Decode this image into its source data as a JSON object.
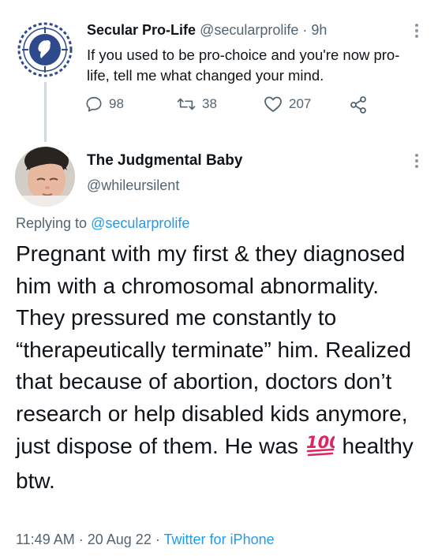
{
  "parent_tweet": {
    "name": "Secular Pro-Life",
    "handle": "@secularprolife",
    "separator": "·",
    "time": "9h",
    "text": "If you used to be pro-choice and you're now pro-life, tell me what changed your mind.",
    "stats": {
      "replies": "98",
      "retweets": "38",
      "likes": "207"
    }
  },
  "reply_tweet": {
    "name": "The Judgmental Baby",
    "handle": "@whileursilent",
    "replying_prefix": "Replying to",
    "replying_to": "@secularprolife",
    "text_part1": "Pregnant with my first & they diagnosed him with a chromosomal abnormality. They pressured me constantly to “therapeutically terminate” him.  Realized that because of abortion, doctors don’t research or help disabled kids anymore, just dispose of them. He was",
    "emoji": "💯",
    "text_part2": "healthy btw.",
    "timestamp": "11:49 AM",
    "date": "20 Aug 22",
    "separator": "·",
    "source": "Twitter for iPhone"
  },
  "colors": {
    "text": "#0f1419",
    "secondary": "#536471",
    "link": "#1d9bf0",
    "logo_blue": "#2f4a8c",
    "emoji_red": "#e0245e"
  },
  "icons": [
    "org-logo-icon",
    "more-options-icon",
    "reply-icon",
    "retweet-icon",
    "like-icon",
    "share-icon",
    "hundred-points-icon"
  ]
}
